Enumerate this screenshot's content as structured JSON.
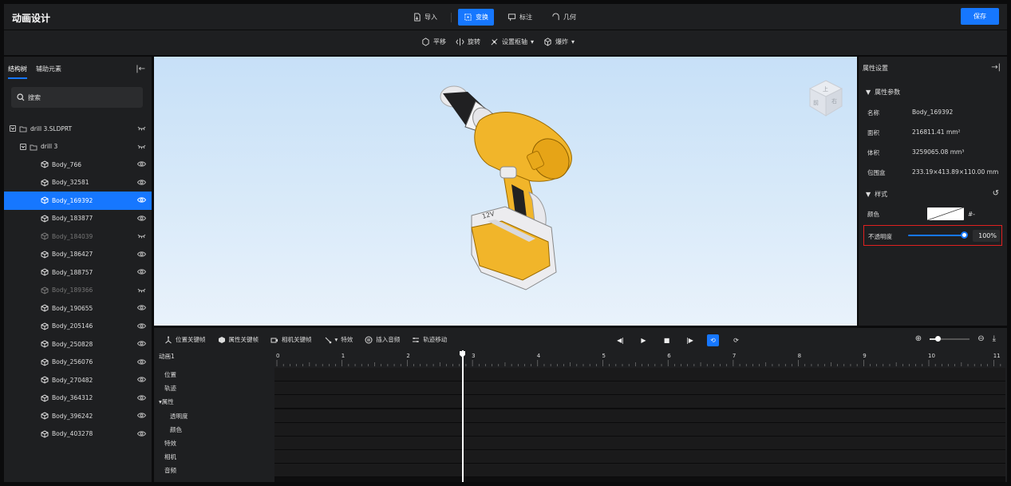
{
  "app_title": "动画设计",
  "modes": [
    {
      "label": "导入",
      "icon": "import-icon",
      "active": false
    },
    {
      "label": "变换",
      "icon": "transform-icon",
      "active": true
    },
    {
      "label": "标注",
      "icon": "annotation-icon",
      "active": false
    },
    {
      "label": "几何",
      "icon": "geometry-icon",
      "active": false
    }
  ],
  "save_label": "保存",
  "subtools": [
    {
      "label": "平移",
      "icon": "move-icon"
    },
    {
      "label": "旋转",
      "icon": "rotate-icon"
    },
    {
      "label": "设置枢轴",
      "icon": "pivot-icon",
      "dropdown": true
    },
    {
      "label": "爆炸",
      "icon": "explode-icon",
      "dropdown": true
    }
  ],
  "left_panel": {
    "tabs": [
      "结构树",
      "辅助元素"
    ],
    "search_placeholder": "搜索",
    "tree": [
      {
        "label": "drill 3.SLDPRT",
        "level": 0,
        "kind": "assembly",
        "hidden": true
      },
      {
        "label": "drill 3",
        "level": 1,
        "kind": "assembly",
        "hidden": true
      },
      {
        "label": "Body_766",
        "level": 2
      },
      {
        "label": "Body_32581",
        "level": 2
      },
      {
        "label": "Body_169392",
        "level": 2,
        "selected": true
      },
      {
        "label": "Body_183877",
        "level": 2
      },
      {
        "label": "Body_184039",
        "level": 2,
        "hidden": true
      },
      {
        "label": "Body_186427",
        "level": 2
      },
      {
        "label": "Body_188757",
        "level": 2
      },
      {
        "label": "Body_189366",
        "level": 2,
        "hidden": true
      },
      {
        "label": "Body_190655",
        "level": 2
      },
      {
        "label": "Body_205146",
        "level": 2
      },
      {
        "label": "Body_250828",
        "level": 2
      },
      {
        "label": "Body_256076",
        "level": 2
      },
      {
        "label": "Body_270482",
        "level": 2
      },
      {
        "label": "Body_364312",
        "level": 2
      },
      {
        "label": "Body_396242",
        "level": 2
      },
      {
        "label": "Body_403278",
        "level": 2
      }
    ]
  },
  "viewport": {
    "model_label": "12V",
    "view_cube_faces": [
      "上",
      "前",
      "右"
    ]
  },
  "right_panel": {
    "title": "属性设置",
    "section_params": "属性参数",
    "props": [
      {
        "key": "名称",
        "value": "Body_169392"
      },
      {
        "key": "面积",
        "value": "216811.41 mm²"
      },
      {
        "key": "体积",
        "value": "3259065.08 mm³"
      },
      {
        "key": "包围盒",
        "value": "233.19×413.89×110.00 mm"
      }
    ],
    "section_style": "样式",
    "color_label": "颜色",
    "color_hex": "#-",
    "opacity_label": "不透明度",
    "opacity_value": "100%",
    "opacity_level": 1.0
  },
  "timeline": {
    "tools": [
      {
        "label": "位置关键帧",
        "icon": "position-keyframe-icon"
      },
      {
        "label": "属性关键帧",
        "icon": "property-keyframe-icon"
      },
      {
        "label": "相机关键帧",
        "icon": "camera-keyframe-icon"
      },
      {
        "label": "特效",
        "icon": "effect-icon"
      },
      {
        "label": "插入音频",
        "icon": "audio-icon"
      },
      {
        "label": "轨迹移动",
        "icon": "track-move-icon"
      }
    ],
    "animation_name": "动画1",
    "ruler_labels": [
      "0",
      "1",
      "2",
      "3",
      "4",
      "5",
      "6",
      "7",
      "8",
      "9",
      "10",
      "11"
    ],
    "tracks": [
      {
        "label": "位置",
        "indent": 1
      },
      {
        "label": "轨迹",
        "indent": 1
      },
      {
        "label": "▾属性",
        "indent": 0
      },
      {
        "label": "透明度",
        "indent": 2
      },
      {
        "label": "颜色",
        "indent": 2
      },
      {
        "label": "特效",
        "indent": 1
      },
      {
        "label": "相机",
        "indent": 1
      },
      {
        "label": "音频",
        "indent": 1
      }
    ],
    "playhead_time": 2.73
  },
  "colors": {
    "accent": "#1677ff",
    "panel": "#1e1f21",
    "highlight_border": "#e02020",
    "drill_yellow": "#f1b52a"
  }
}
